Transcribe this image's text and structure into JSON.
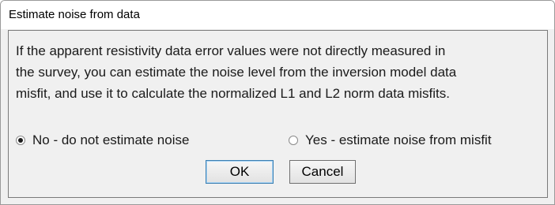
{
  "dialog": {
    "title": "Estimate noise from data",
    "message_lines": [
      "If the apparent resistivity data error values were not directly measured in",
      "the survey, you can estimate the noise level from the inversion model data",
      "misfit, and use it to calculate the normalized L1 and L2 norm data misfits."
    ],
    "options": [
      {
        "label": "No - do not estimate noise",
        "selected": true
      },
      {
        "label": "Yes - estimate noise from misfit",
        "selected": false
      }
    ],
    "buttons": {
      "ok_label": "OK",
      "cancel_label": "Cancel"
    }
  }
}
